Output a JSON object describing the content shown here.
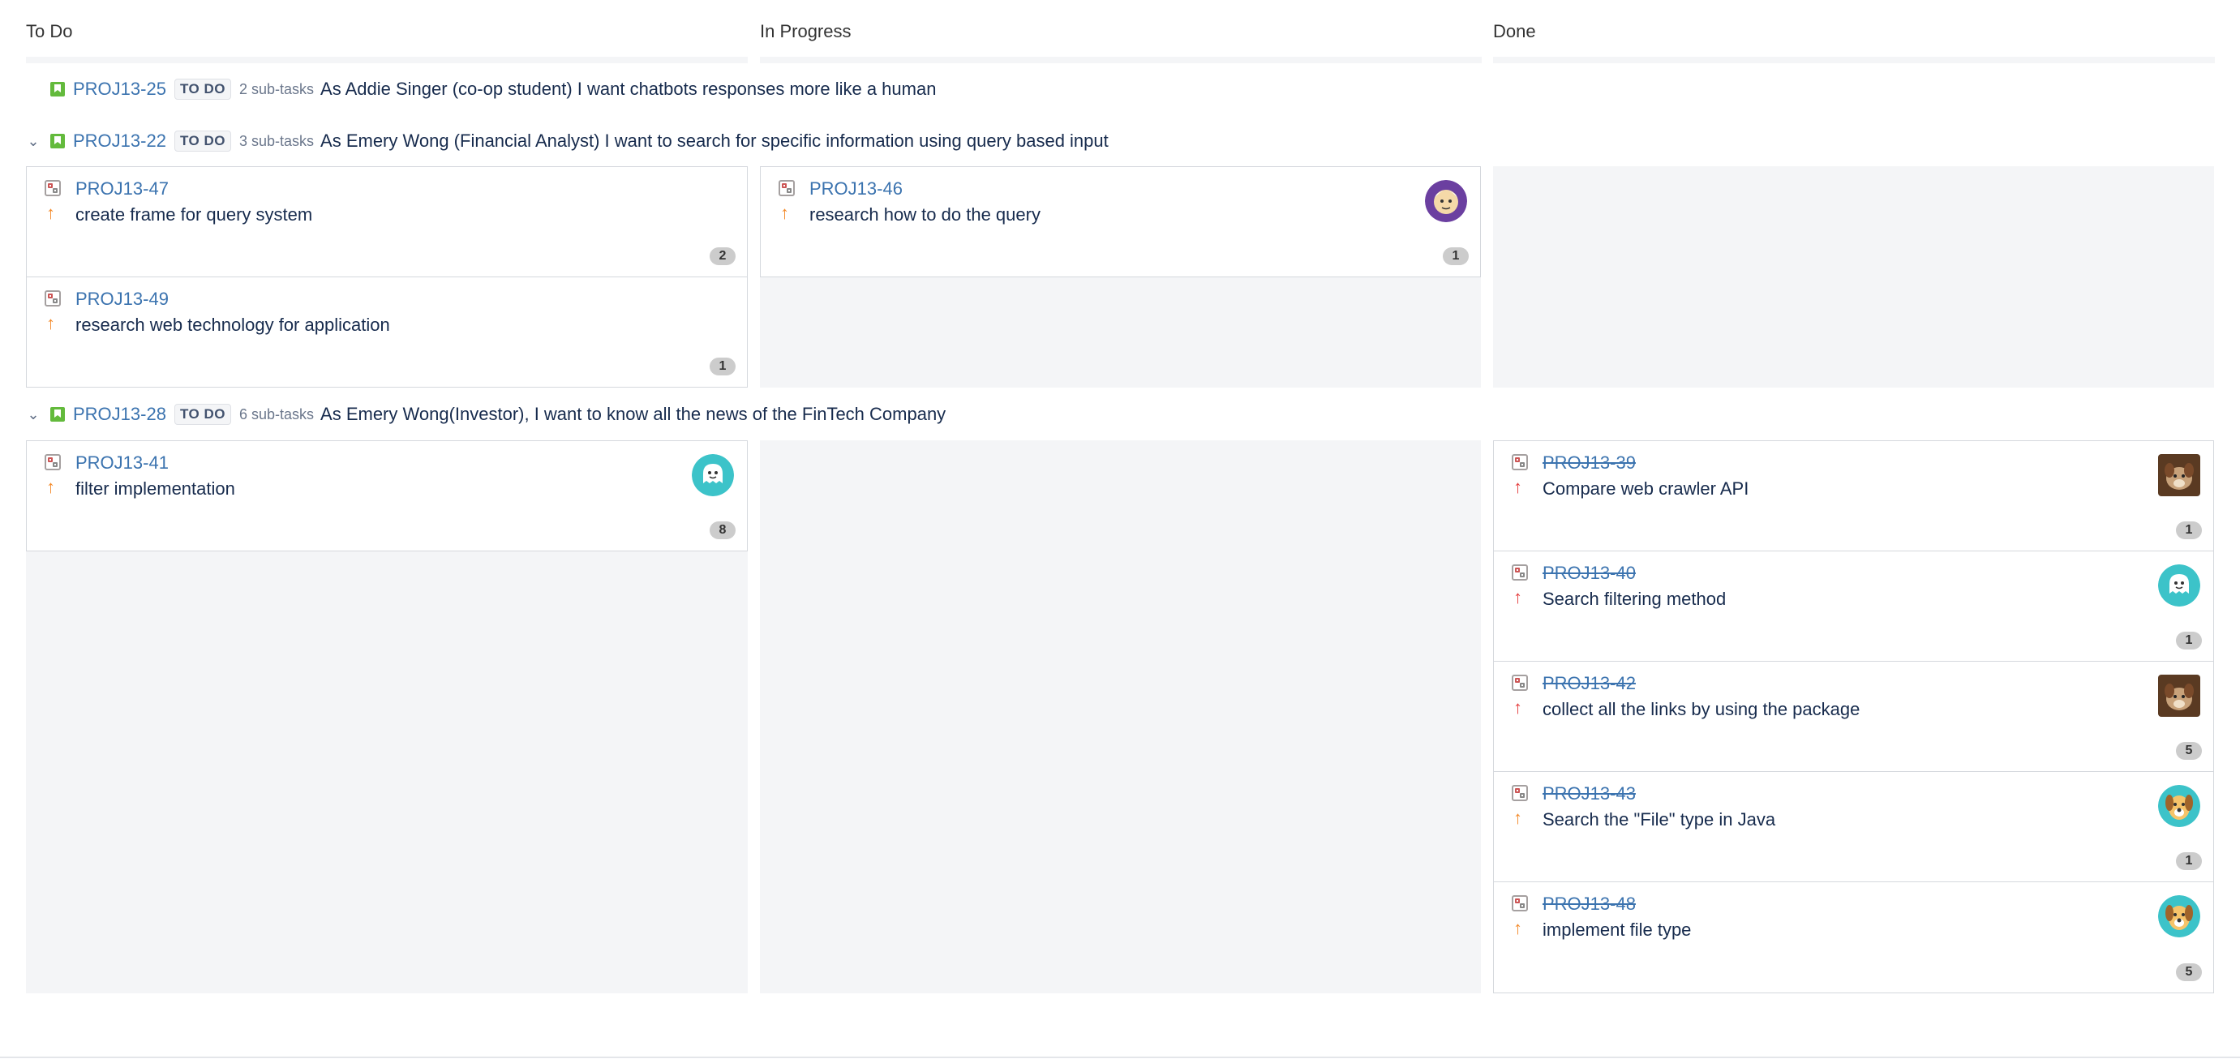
{
  "columns": [
    {
      "title": "To Do"
    },
    {
      "title": "In Progress"
    },
    {
      "title": "Done"
    }
  ],
  "swimlanes": [
    {
      "key": "PROJ13-25",
      "status": "TO DO",
      "subtasks": "2 sub-tasks",
      "summary": "As Addie Singer (co-op student) I want chatbots responses more like a human",
      "collapsible": false
    },
    {
      "key": "PROJ13-22",
      "status": "TO DO",
      "subtasks": "3 sub-tasks",
      "summary": "As Emery Wong (Financial Analyst) I want to search for specific information using query based input",
      "collapsible": true,
      "expand_icon": "chevron-down-icon"
    },
    {
      "key": "PROJ13-28",
      "status": "TO DO",
      "subtasks": "6 sub-tasks",
      "summary": "As Emery Wong(Investor), I want to know all the news of the FinTech Company",
      "collapsible": true,
      "expand_icon": "chevron-down-icon"
    }
  ],
  "cards": {
    "c47": {
      "key": "PROJ13-47",
      "summary": "create frame for query system",
      "priority": "medium",
      "count": "2"
    },
    "c49": {
      "key": "PROJ13-49",
      "summary": "research web technology for application",
      "priority": "medium",
      "count": "1"
    },
    "c46": {
      "key": "PROJ13-46",
      "summary": "research how to do the query",
      "priority": "medium",
      "count": "1",
      "avatar": "old-man-avatar"
    },
    "c41": {
      "key": "PROJ13-41",
      "summary": "filter implementation",
      "priority": "medium",
      "count": "8",
      "avatar": "ghost-avatar"
    },
    "c39": {
      "key": "PROJ13-39",
      "summary": "Compare web crawler API",
      "priority": "high",
      "count": "1",
      "avatar": "dog-photo-avatar",
      "done": true
    },
    "c40": {
      "key": "PROJ13-40",
      "summary": "Search filtering method",
      "priority": "high",
      "count": "1",
      "avatar": "ghost-avatar",
      "done": true
    },
    "c42": {
      "key": "PROJ13-42",
      "summary": "collect all the links by using the package",
      "priority": "high",
      "count": "5",
      "avatar": "dog-photo-avatar",
      "done": true
    },
    "c43": {
      "key": "PROJ13-43",
      "summary": "Search the \"File\" type in Java",
      "priority": "medium",
      "count": "1",
      "avatar": "dog-cartoon-avatar",
      "done": true
    },
    "c48": {
      "key": "PROJ13-48",
      "summary": "implement file type",
      "priority": "medium",
      "count": "5",
      "avatar": "dog-cartoon-avatar",
      "done": true
    }
  },
  "icons": {
    "issue_type": "subtask-icon",
    "story": "story-icon",
    "priority_medium": "arrow-up-icon",
    "priority_high": "arrow-up-icon"
  },
  "colors": {
    "link": "#3b73af",
    "story": "#63ba3c",
    "priority_medium": "#f48b2b",
    "priority_high": "#e53e3e",
    "column_bg": "#f4f5f7"
  }
}
